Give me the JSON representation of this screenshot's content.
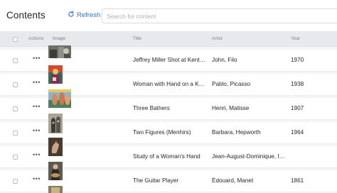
{
  "header": {
    "title": "Contents",
    "refresh_label": "Refresh",
    "search_placeholder": "Search for content"
  },
  "table": {
    "columns": {
      "actions": "Actions",
      "image": "Image",
      "title": "Title",
      "artist": "Artist",
      "year": "Year"
    },
    "rows": [
      {
        "title": "Jeffrey Miller Shot at Kent State",
        "artist": "John, Filo",
        "year": "1970",
        "thumb": "photograph-thumbnail"
      },
      {
        "title": "Woman with Hand on a Knee",
        "artist": "Pablo, Picasso",
        "year": "1938",
        "thumb": "painting-thumbnail"
      },
      {
        "title": "Three Bathers",
        "artist": "Henri, Matisse",
        "year": "1907",
        "thumb": "painting-thumbnail"
      },
      {
        "title": "Two Figures (Menhirs)",
        "artist": "Barbara, Hepworth",
        "year": "1964",
        "thumb": "sculpture-thumbnail"
      },
      {
        "title": "Study of a Woman's Hand",
        "artist": "Jean-August-Dominique, Ingres",
        "year": "",
        "thumb": "drawing-thumbnail"
      },
      {
        "title": "The Guitar Player",
        "artist": "Édouard, Manet",
        "year": "1861",
        "thumb": "painting-thumbnail"
      }
    ]
  },
  "colors": {
    "accent": "#2f6fd1",
    "header_bg": "#e7e9ec",
    "page_bg": "#f3f4f6"
  }
}
